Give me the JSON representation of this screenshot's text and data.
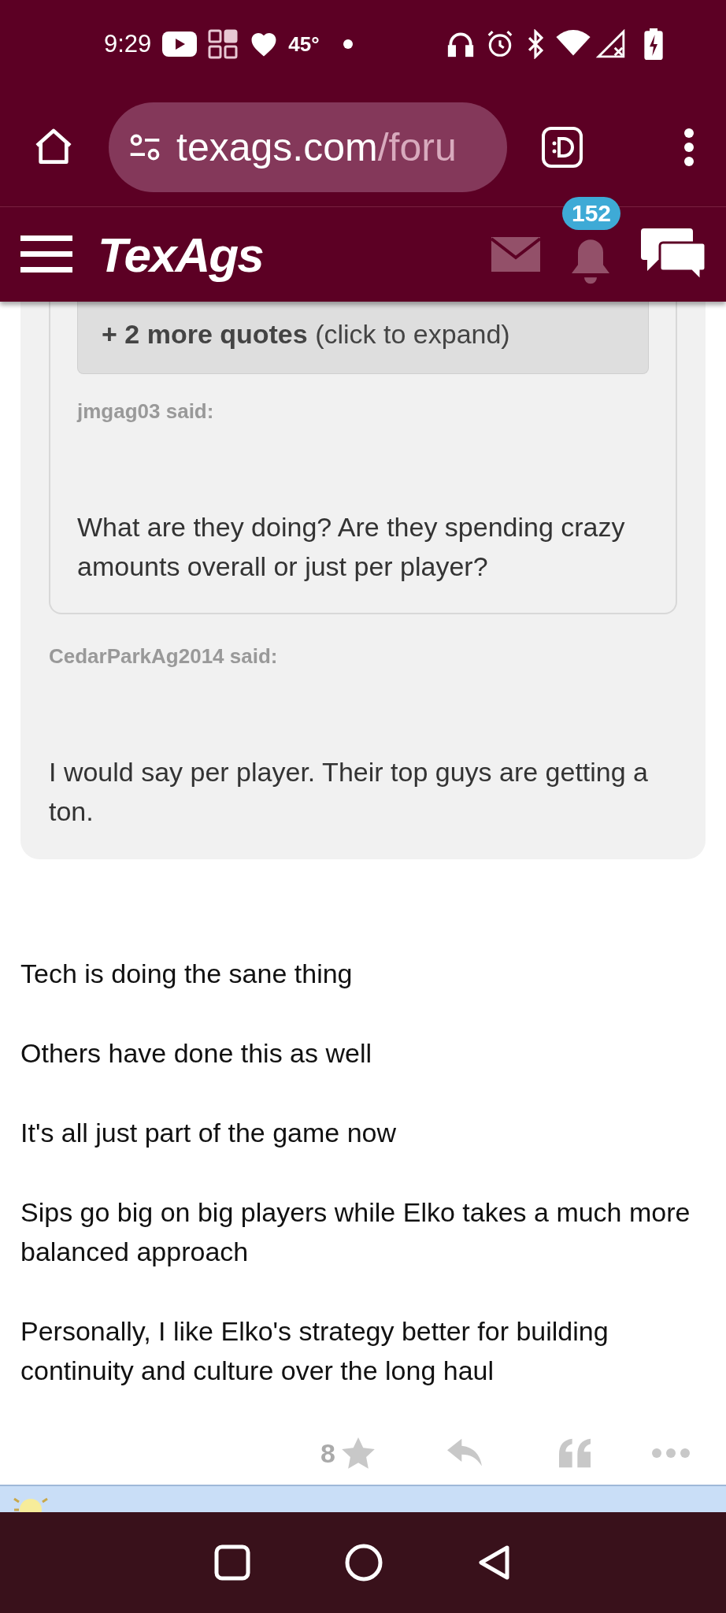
{
  "status_bar": {
    "time": "9:29",
    "temperature": "45°"
  },
  "browser": {
    "url_host": "texags.com",
    "url_path": "/foru"
  },
  "site_header": {
    "logo": "TexAgs",
    "notification_count": "152"
  },
  "outer_quote": {
    "author": "CedarParkAg2014 said:",
    "text": "I would say per player. Their top guys are getting a ton.",
    "inner_quote": {
      "more_quotes": "**+ 2 more quotes** (click to expand)",
      "author": "jmgag03 said:",
      "text": "What are they doing? Are they spending crazy amounts overall or just per player?"
    }
  },
  "post_paragraphs": [
    "Tech is doing the sane thing",
    "Others have done this as well",
    "It's all just part of the game now",
    "Sips go big on big players while Elko takes a much more balanced approach",
    "Personally, I like Elko's strategy better for building continuity and culture over the long haul"
  ],
  "post_actions": {
    "star_count": "8"
  }
}
